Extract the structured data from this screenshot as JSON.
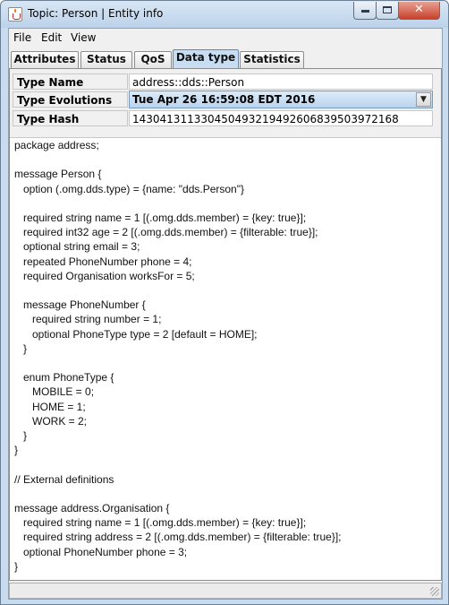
{
  "window": {
    "title": "Topic: Person | Entity info"
  },
  "menu": {
    "file": "File",
    "edit": "Edit",
    "view": "View"
  },
  "tabs": [
    "Attributes",
    "Status",
    "QoS",
    "Data type",
    "Statistics"
  ],
  "props": {
    "type_name_label": "Type Name",
    "type_name_value": "address::dds::Person",
    "type_evolutions_label": "Type Evolutions",
    "type_evolutions_value": "Tue Apr 26 16:59:08 EDT 2016",
    "type_hash_label": "Type Hash",
    "type_hash_value": "143041311330450493219492606839503972168"
  },
  "code": "package address;\n\nmessage Person {\n   option (.omg.dds.type) = {name: \"dds.Person\"}\n\n   required string name = 1 [(.omg.dds.member) = {key: true}];\n   required int32 age = 2 [(.omg.dds.member) = {filterable: true}];\n   optional string email = 3;\n   repeated PhoneNumber phone = 4;\n   required Organisation worksFor = 5;\n\n   message PhoneNumber {\n      required string number = 1;\n      optional PhoneType type = 2 [default = HOME];\n   }\n\n   enum PhoneType {\n      MOBILE = 0;\n      HOME = 1;\n      WORK = 2;\n   }\n}\n\n// External definitions\n\nmessage address.Organisation {\n   required string name = 1 [(.omg.dds.member) = {key: true}];\n   required string address = 2 [(.omg.dds.member) = {filterable: true}];\n   optional PhoneNumber phone = 3;\n}",
  "icons": {
    "app": "java-cup-icon",
    "minimize": "minimize-icon",
    "maximize": "maximize-icon",
    "close": "close-icon",
    "dropdown": "chevron-down-icon"
  }
}
